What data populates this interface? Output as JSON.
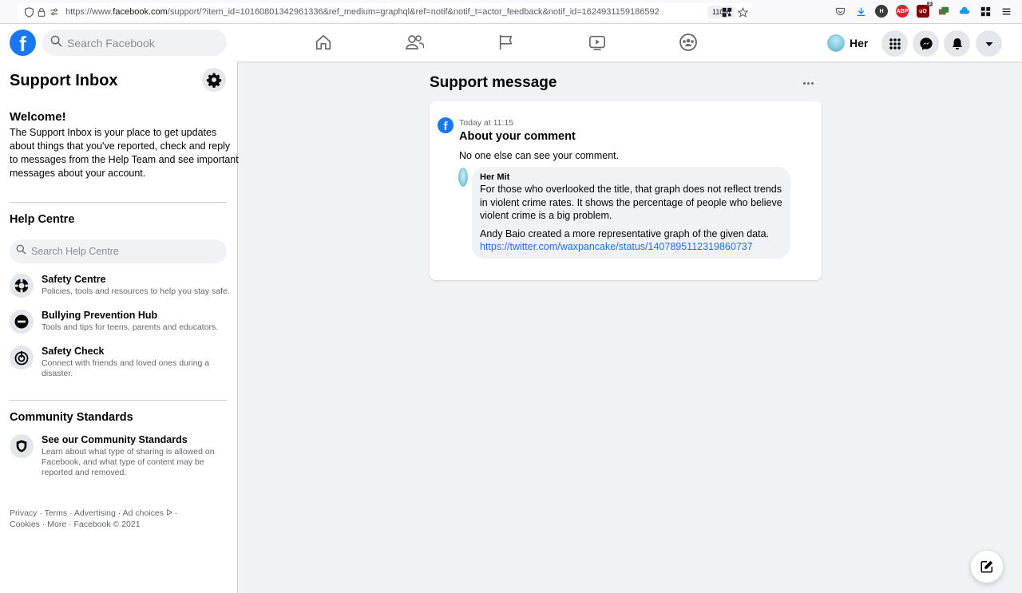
{
  "browser": {
    "url_prefix": "https://www.",
    "url_domain": "facebook.com",
    "url_rest": "/support/?item_id=10160801342961336&ref_medium=graphql&ref=notif&notif_t=actor_feedback&notif_id=1624931159186592",
    "zoom": "110%",
    "ext_abp": "ABP",
    "ext_ub_badge": "3"
  },
  "nav": {
    "search_placeholder": "Search Facebook",
    "profile_name": "Her",
    "logo_letter": "f"
  },
  "sidebar": {
    "title": "Support Inbox",
    "welcome_title": "Welcome!",
    "welcome_text": "The Support Inbox is your place to get updates about things that you've reported, check and reply to messages from the Help Team and see important messages about your account.",
    "help_centre_title": "Help Centre",
    "help_search_placeholder": "Search Help Centre",
    "help_items": [
      {
        "name": "Safety Centre",
        "desc": "Policies, tools and resources to help you stay safe."
      },
      {
        "name": "Bullying Prevention Hub",
        "desc": "Tools and tips for teens, parents and educators."
      },
      {
        "name": "Safety Check",
        "desc": "Connect with friends and loved ones during a disaster."
      }
    ],
    "community_title": "Community Standards",
    "community_item": {
      "name": "See our Community Standards",
      "desc": "Learn about what type of sharing is allowed on Facebook, and what type of content may be reported and removed."
    },
    "footer_line1": "Privacy · Terms · Advertising · Ad choices ",
    "footer_ad_glyph": "ᐅ",
    "footer_sep": " ·",
    "footer_line2": "Cookies · More · Facebook © 2021"
  },
  "main": {
    "title": "Support message",
    "message": {
      "time": "Today at 11:15",
      "title": "About your comment",
      "body": "No one else can see your comment.",
      "comment": {
        "author": "Her Mit",
        "text": "For those who overlooked the title, that graph does not reflect trends in violent crime rates. It shows the percentage of people who believe violent crime is a big problem.",
        "text2": "Andy Baio created a more representative graph of the given data.",
        "link": "https://twitter.com/waxpancake/status/1407895112319860737"
      }
    }
  },
  "colors": {
    "brand": "#1877f2",
    "link": "#216fdb",
    "background": "#f0f2f5"
  }
}
